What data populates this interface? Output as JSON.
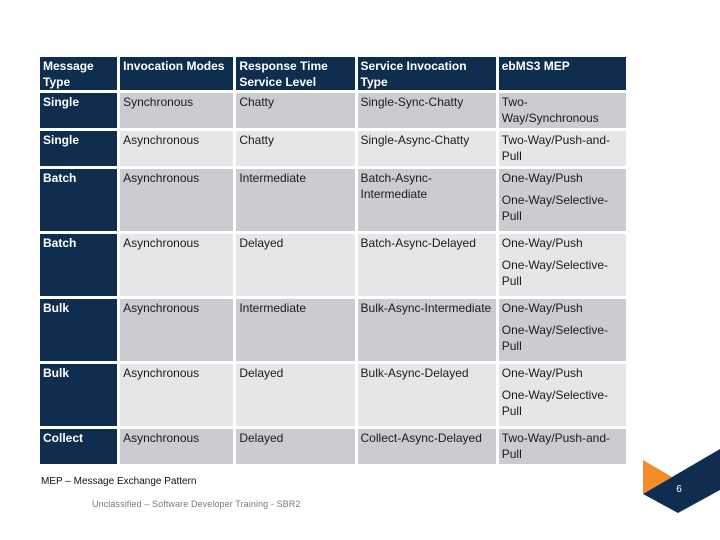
{
  "table": {
    "headers": [
      "Message Type",
      "Invocation Modes",
      "Response Time Service Level",
      "Service Invocation Type",
      "ebMS3 MEP"
    ],
    "rows": [
      {
        "message_type": "Single",
        "invocation_mode": "Synchronous",
        "response_time": "Chatty",
        "service_invocation_type": "Single-Sync-Chatty",
        "mep": [
          "Two-Way/Synchronous"
        ]
      },
      {
        "message_type": "Single",
        "invocation_mode": "Asynchronous",
        "response_time": "Chatty",
        "service_invocation_type": "Single-Async-Chatty",
        "mep": [
          "Two-Way/Push-and-Pull"
        ]
      },
      {
        "message_type": "Batch",
        "invocation_mode": "Asynchronous",
        "response_time": "Intermediate",
        "service_invocation_type": "Batch-Async-Intermediate",
        "mep": [
          "One-Way/Push",
          "One-Way/Selective-Pull"
        ]
      },
      {
        "message_type": "Batch",
        "invocation_mode": "Asynchronous",
        "response_time": "Delayed",
        "service_invocation_type": "Batch-Async-Delayed",
        "mep": [
          "One-Way/Push",
          "One-Way/Selective-Pull"
        ]
      },
      {
        "message_type": "Bulk",
        "invocation_mode": "Asynchronous",
        "response_time": "Intermediate",
        "service_invocation_type": "Bulk-Async-Intermediate",
        "mep": [
          "One-Way/Push",
          "One-Way/Selective-Pull"
        ]
      },
      {
        "message_type": "Bulk",
        "invocation_mode": "Asynchronous",
        "response_time": "Delayed",
        "service_invocation_type": "Bulk-Async-Delayed",
        "mep": [
          "One-Way/Push",
          "One-Way/Selective-Pull"
        ]
      },
      {
        "message_type": "Collect",
        "invocation_mode": "Asynchronous",
        "response_time": "Delayed",
        "service_invocation_type": "Collect-Async-Delayed",
        "mep": [
          "Two-Way/Push-and-Pull"
        ]
      }
    ]
  },
  "footnote": "MEP – Message Exchange Pattern",
  "footer": "Unclassified – Software Developer Training - SBR2",
  "page_number": "6",
  "colors": {
    "header_navy": "#0f2d4e",
    "row_dark": "#cbcccf",
    "row_light": "#e5e6e8",
    "accent_orange": "#f28c28"
  }
}
